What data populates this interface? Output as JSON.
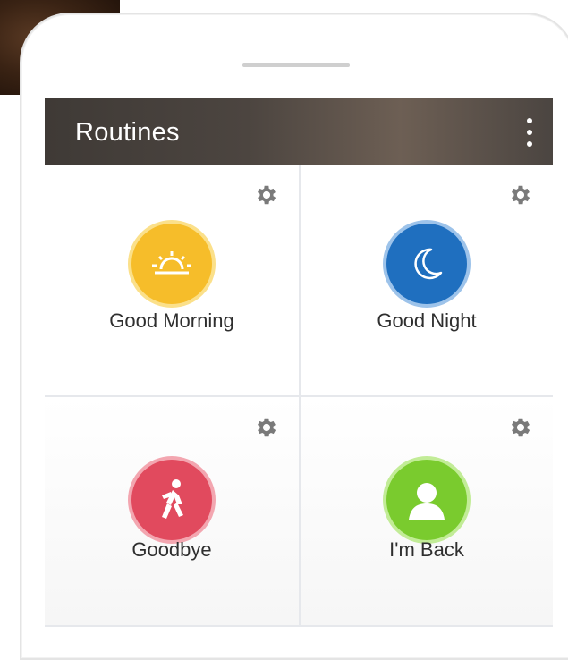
{
  "app": {
    "title": "Routines"
  },
  "routines": [
    {
      "label": "Good Morning",
      "icon": "sunrise-icon",
      "color": "#f6bd2a"
    },
    {
      "label": "Good Night",
      "icon": "moon-icon",
      "color": "#1f6fbf"
    },
    {
      "label": "Goodbye",
      "icon": "walking-person-icon",
      "color": "#e14a5e"
    },
    {
      "label": "I'm Back",
      "icon": "person-icon",
      "color": "#7acb2e"
    }
  ],
  "colors": {
    "appbar": "#4c4540",
    "gear": "#7a7a7a",
    "label": "#2f2f2f"
  }
}
